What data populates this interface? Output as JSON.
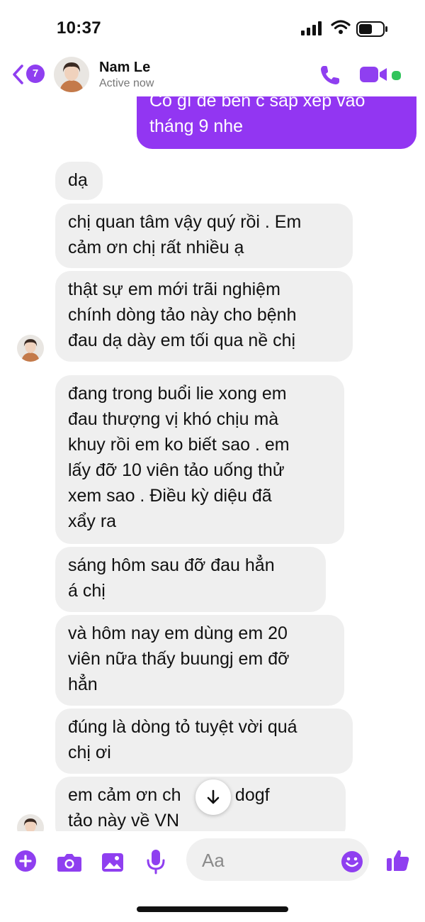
{
  "status_bar": {
    "time": "10:37"
  },
  "header": {
    "back_count": "7",
    "contact_name": "Nam Le",
    "presence": "Active now",
    "accent_color": "#8f3ff0",
    "online_color": "#31c45b"
  },
  "messages": [
    {
      "direction": "outgoing",
      "lines": [
        "Có gì để bên c sắp xếp vào",
        "tháng 9 nhe"
      ]
    },
    {
      "direction": "incoming",
      "lines": [
        "dạ"
      ]
    },
    {
      "direction": "incoming",
      "lines": [
        "chị quan tâm vậy quý rồi . Em",
        "cảm ơn chị rất nhiều ạ"
      ]
    },
    {
      "direction": "incoming",
      "lines": [
        "thật sự em mới trãi nghiệm",
        "chính dòng tảo này cho bệnh",
        "đau dạ dày em tối qua nề chị"
      ]
    },
    {
      "direction": "incoming",
      "lines": [
        "đang trong buổi lie xong em",
        "đau thượng vị khó chịu mà",
        "khuy rồi em ko biết sao . em",
        "lấy đỡ 10 viên tảo uống thử",
        "xem sao . Điều kỳ diệu đã",
        "xẩy ra"
      ]
    },
    {
      "direction": "incoming",
      "lines": [
        "sáng hôm sau đỡ đau hẳn",
        "á chị"
      ]
    },
    {
      "direction": "incoming",
      "lines": [
        "và hôm nay em dùng em 20",
        "viên nữa thấy buungj em đỡ",
        "hẳn"
      ]
    },
    {
      "direction": "incoming",
      "lines": [
        "đúng là dòng tỏ tuyệt vời quá",
        "chị ơi"
      ]
    },
    {
      "direction": "incoming",
      "lines": [
        "em cảm ơn ch   đem dogf",
        "tảo này về VN"
      ]
    }
  ],
  "composer": {
    "placeholder": "Aa",
    "icons": [
      "add-icon",
      "camera-icon",
      "image-icon",
      "microphone-icon",
      "emoji-icon",
      "thumbs-up-icon"
    ]
  },
  "colors": {
    "outgoing_bubble": "#9236f2",
    "incoming_bubble": "#efefef"
  }
}
